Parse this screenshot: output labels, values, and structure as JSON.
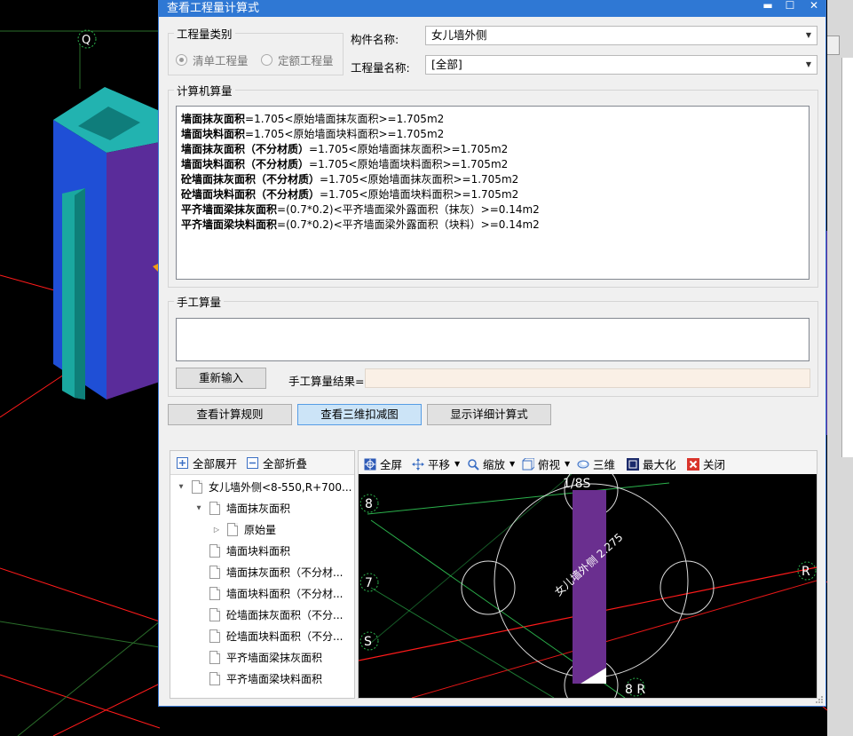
{
  "window_title": "查看工程量计算式",
  "window_controls": {
    "minimize": "▬",
    "maximize": "☐",
    "close": "✕"
  },
  "quantity_type": {
    "group_label": "工程量类别",
    "options": [
      "清单工程量",
      "定额工程量"
    ],
    "selected": "清单工程量"
  },
  "component_name": {
    "label": "构件名称:",
    "value": "女儿墙外侧"
  },
  "quantity_name": {
    "label": "工程量名称:",
    "value": "[全部]"
  },
  "computer_calc": {
    "group_label": "计算机算量",
    "lines": [
      {
        "name": "墙面抹灰面积",
        "formula": "=1.705<原始墙面抹灰面积>=1.705m2"
      },
      {
        "name": "墙面块料面积",
        "formula": "=1.705<原始墙面块料面积>=1.705m2"
      },
      {
        "name": "墙面抹灰面积（不分材质）",
        "formula": "=1.705<原始墙面抹灰面积>=1.705m2"
      },
      {
        "name": "墙面块料面积（不分材质）",
        "formula": "=1.705<原始墙面块料面积>=1.705m2"
      },
      {
        "name": "砼墙面抹灰面积（不分材质）",
        "formula": "=1.705<原始墙面抹灰面积>=1.705m2"
      },
      {
        "name": "砼墙面块料面积（不分材质）",
        "formula": "=1.705<原始墙面块料面积>=1.705m2"
      },
      {
        "name": "平齐墙面梁抹灰面积",
        "formula": "=(0.7*0.2)<平齐墙面梁外露面积（抹灰）>=0.14m2"
      },
      {
        "name": "平齐墙面梁块料面积",
        "formula": "=(0.7*0.2)<平齐墙面梁外露面积（块料）>=0.14m2"
      }
    ]
  },
  "manual_calc": {
    "group_label": "手工算量",
    "reset_button": "重新输入",
    "result_label": "手工算量结果=",
    "result_value": ""
  },
  "actions": {
    "view_rules": "查看计算规则",
    "view_3d_deduction": "查看三维扣减图",
    "show_detail_formula": "显示详细计算式"
  },
  "tree": {
    "expand_all": "全部展开",
    "collapse_all": "全部折叠",
    "items": [
      {
        "label": "女儿墙外侧<8-550,R+700...",
        "level": 0,
        "toggle": "▲"
      },
      {
        "label": "墙面抹灰面积",
        "level": 1,
        "toggle": "▲"
      },
      {
        "label": "原始量",
        "level": 2,
        "toggle": "▷"
      },
      {
        "label": "墙面块料面积",
        "level": 1,
        "toggle": ""
      },
      {
        "label": "墙面抹灰面积（不分材...",
        "level": 1,
        "toggle": ""
      },
      {
        "label": "墙面块料面积（不分材...",
        "level": 1,
        "toggle": ""
      },
      {
        "label": "砼墙面抹灰面积（不分...",
        "level": 1,
        "toggle": ""
      },
      {
        "label": "砼墙面块料面积（不分...",
        "level": 1,
        "toggle": ""
      },
      {
        "label": "平齐墙面梁抹灰面积",
        "level": 1,
        "toggle": ""
      },
      {
        "label": "平齐墙面梁块料面积",
        "level": 1,
        "toggle": ""
      }
    ]
  },
  "viewer": {
    "toolbar": {
      "fullscreen": "全屏",
      "pan": "平移",
      "zoom": "缩放",
      "top_view": "俯视",
      "three_d": "三维",
      "maximize": "最大化",
      "close": "关闭"
    },
    "labels": {
      "axis_top": "1/8S",
      "axis_8": "8",
      "axis_7": "7",
      "axis_s": "S",
      "axis_r": "R",
      "axis_8r": "8 R",
      "wall_label": "女儿墙外侧 2.275"
    }
  },
  "background_labels": {
    "axis_q": "Q"
  },
  "colors": {
    "title_bar": "#2f78d4",
    "wall_purple": "#6a2f8f",
    "axis_red": "#ff1a1a",
    "axis_green": "#2bb24c"
  }
}
